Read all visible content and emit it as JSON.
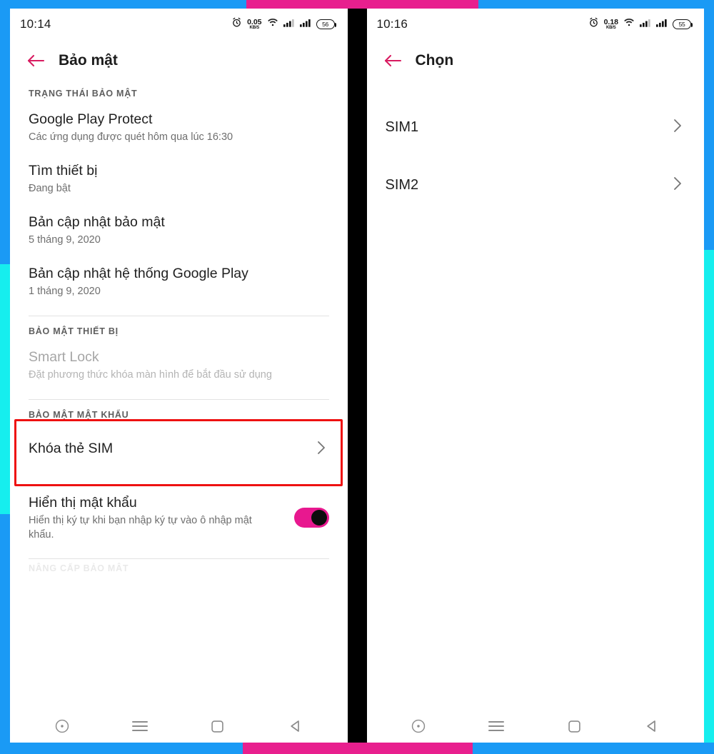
{
  "frame": {
    "border_blue": "#1a9af5",
    "border_cyan": "#16eeee",
    "border_pink": "#e81f8e",
    "gutter_black": "#000000"
  },
  "accent": {
    "back_arrow": "#d81b60",
    "toggle_on": "#e8188f",
    "highlight_red": "#ee1111"
  },
  "left_phone": {
    "status_bar": {
      "time": "10:14",
      "alarm_icon": "alarm-clock-icon",
      "net_speed_value": "0.05",
      "net_speed_unit": "KB/S",
      "wifi_icon": "wifi-icon",
      "signal1_icon": "signal-bars-icon",
      "signal2_icon": "signal-bars-icon",
      "battery_icon": "battery-icon",
      "battery_level": "56"
    },
    "app_bar": {
      "back_icon": "back-arrow-icon",
      "title": "Bảo mật"
    },
    "sections": [
      {
        "header": "TRẠNG THÁI BẢO MẬT",
        "items": [
          {
            "title": "Google Play Protect",
            "subtitle": "Các ứng dụng được quét hôm qua lúc 16:30"
          },
          {
            "title": "Tìm thiết bị",
            "subtitle": "Đang bật"
          },
          {
            "title": "Bản cập nhật bảo mật",
            "subtitle": "5 tháng 9, 2020"
          },
          {
            "title": "Bản cập nhật hệ thống Google Play",
            "subtitle": "1 tháng 9, 2020"
          }
        ]
      },
      {
        "header": "BẢO MẬT THIẾT BỊ",
        "items": [
          {
            "title": "Smart Lock",
            "subtitle": "Đặt phương thức khóa màn hình để bắt đầu sử dụng"
          }
        ]
      },
      {
        "header": "BẢO MẬT MẬT KHẨU",
        "items": [
          {
            "title": "Khóa thẻ SIM",
            "subtitle": ""
          },
          {
            "title": "Hiển thị mật khẩu",
            "subtitle": "Hiển thị ký tự khi bạn nhập ký tự vào ô nhập mật khẩu."
          }
        ]
      }
    ],
    "cutoff_text": "NÂNG CẤP BẢO MẬT",
    "show_password_toggle_state": "on"
  },
  "right_phone": {
    "status_bar": {
      "time": "10:16",
      "alarm_icon": "alarm-clock-icon",
      "net_speed_value": "0.18",
      "net_speed_unit": "KB/S",
      "wifi_icon": "wifi-icon",
      "signal1_icon": "signal-bars-icon",
      "signal2_icon": "signal-bars-icon",
      "battery_icon": "battery-icon",
      "battery_level": "55"
    },
    "app_bar": {
      "back_icon": "back-arrow-icon",
      "title": "Chọn"
    },
    "sim_items": [
      {
        "title": "SIM1"
      },
      {
        "title": "SIM2"
      }
    ]
  },
  "nav_bar": {
    "buttons": [
      {
        "icon": "assistant-circle-icon",
        "label": "Assistant"
      },
      {
        "icon": "menu-hamburger-icon",
        "label": "Menu"
      },
      {
        "icon": "recents-square-icon",
        "label": "Recents"
      },
      {
        "icon": "back-triangle-icon",
        "label": "Back"
      }
    ]
  }
}
